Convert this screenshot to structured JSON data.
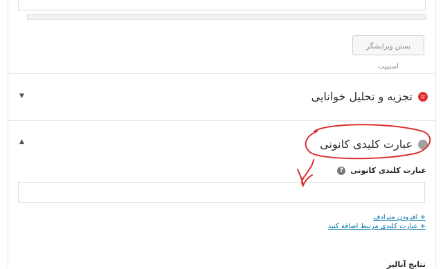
{
  "close_snippet_button": "بستن ویرایشگر اسنیپت",
  "readability": {
    "title": "تجزیه و تحلیل خوانایی",
    "status_color": "#dc3232",
    "status_icon": "sad-face-icon",
    "toggle_icon": "▼"
  },
  "focus_keyword": {
    "title": "عبارت کلیدی کانونی",
    "status_color": "#a0a0a0",
    "toggle_icon": "▲",
    "field_label": "عبارت کلیدی کانونی",
    "help_icon": "?",
    "input_value": "",
    "add_synonyms": "+ افزودن مترادف",
    "add_related": "+ عبارت کلیدی مرتبط اضافه کنید",
    "results_title": "نتایج آنالیز"
  },
  "annotation_color": "#d9302c"
}
